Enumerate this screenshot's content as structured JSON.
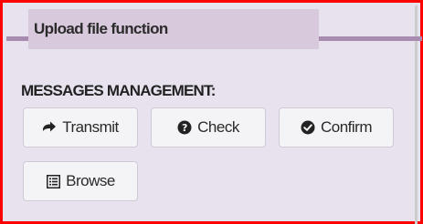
{
  "panel": {
    "title": "Upload file function",
    "section_label": "MESSAGES MANAGEMENT:"
  },
  "buttons": {
    "transmit": {
      "label": "Transmit",
      "icon": "arrow-right-icon"
    },
    "check": {
      "label": "Check",
      "icon": "question-circle-icon"
    },
    "confirm": {
      "label": "Confirm",
      "icon": "check-circle-icon"
    },
    "browse": {
      "label": "Browse",
      "icon": "list-icon"
    }
  },
  "colors": {
    "highlight_border": "#ff0000",
    "panel_background": "#e7e2ee",
    "title_tab": "#d8c9dc",
    "title_line": "#a78bb0"
  }
}
